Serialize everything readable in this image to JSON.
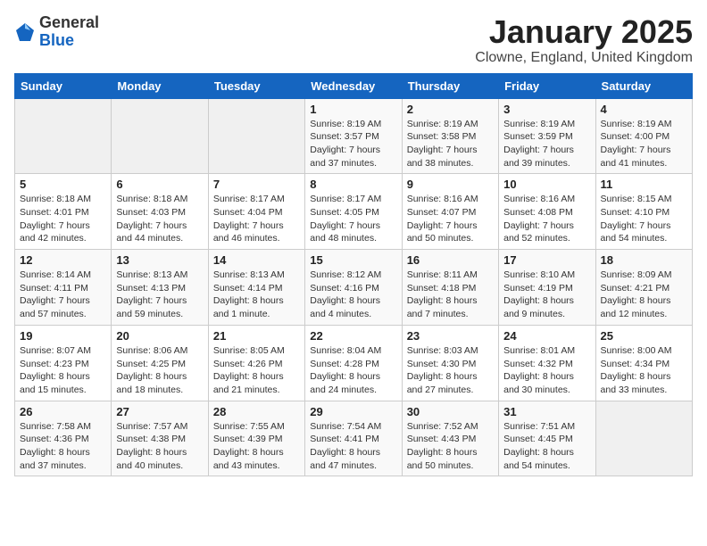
{
  "header": {
    "logo_general": "General",
    "logo_blue": "Blue",
    "title": "January 2025",
    "subtitle": "Clowne, England, United Kingdom"
  },
  "weekdays": [
    "Sunday",
    "Monday",
    "Tuesday",
    "Wednesday",
    "Thursday",
    "Friday",
    "Saturday"
  ],
  "weeks": [
    [
      {
        "day": "",
        "empty": true
      },
      {
        "day": "",
        "empty": true
      },
      {
        "day": "",
        "empty": true
      },
      {
        "day": "1",
        "info": "Sunrise: 8:19 AM\nSunset: 3:57 PM\nDaylight: 7 hours\nand 37 minutes."
      },
      {
        "day": "2",
        "info": "Sunrise: 8:19 AM\nSunset: 3:58 PM\nDaylight: 7 hours\nand 38 minutes."
      },
      {
        "day": "3",
        "info": "Sunrise: 8:19 AM\nSunset: 3:59 PM\nDaylight: 7 hours\nand 39 minutes."
      },
      {
        "day": "4",
        "info": "Sunrise: 8:19 AM\nSunset: 4:00 PM\nDaylight: 7 hours\nand 41 minutes."
      }
    ],
    [
      {
        "day": "5",
        "info": "Sunrise: 8:18 AM\nSunset: 4:01 PM\nDaylight: 7 hours\nand 42 minutes."
      },
      {
        "day": "6",
        "info": "Sunrise: 8:18 AM\nSunset: 4:03 PM\nDaylight: 7 hours\nand 44 minutes."
      },
      {
        "day": "7",
        "info": "Sunrise: 8:17 AM\nSunset: 4:04 PM\nDaylight: 7 hours\nand 46 minutes."
      },
      {
        "day": "8",
        "info": "Sunrise: 8:17 AM\nSunset: 4:05 PM\nDaylight: 7 hours\nand 48 minutes."
      },
      {
        "day": "9",
        "info": "Sunrise: 8:16 AM\nSunset: 4:07 PM\nDaylight: 7 hours\nand 50 minutes."
      },
      {
        "day": "10",
        "info": "Sunrise: 8:16 AM\nSunset: 4:08 PM\nDaylight: 7 hours\nand 52 minutes."
      },
      {
        "day": "11",
        "info": "Sunrise: 8:15 AM\nSunset: 4:10 PM\nDaylight: 7 hours\nand 54 minutes."
      }
    ],
    [
      {
        "day": "12",
        "info": "Sunrise: 8:14 AM\nSunset: 4:11 PM\nDaylight: 7 hours\nand 57 minutes."
      },
      {
        "day": "13",
        "info": "Sunrise: 8:13 AM\nSunset: 4:13 PM\nDaylight: 7 hours\nand 59 minutes."
      },
      {
        "day": "14",
        "info": "Sunrise: 8:13 AM\nSunset: 4:14 PM\nDaylight: 8 hours\nand 1 minute."
      },
      {
        "day": "15",
        "info": "Sunrise: 8:12 AM\nSunset: 4:16 PM\nDaylight: 8 hours\nand 4 minutes."
      },
      {
        "day": "16",
        "info": "Sunrise: 8:11 AM\nSunset: 4:18 PM\nDaylight: 8 hours\nand 7 minutes."
      },
      {
        "day": "17",
        "info": "Sunrise: 8:10 AM\nSunset: 4:19 PM\nDaylight: 8 hours\nand 9 minutes."
      },
      {
        "day": "18",
        "info": "Sunrise: 8:09 AM\nSunset: 4:21 PM\nDaylight: 8 hours\nand 12 minutes."
      }
    ],
    [
      {
        "day": "19",
        "info": "Sunrise: 8:07 AM\nSunset: 4:23 PM\nDaylight: 8 hours\nand 15 minutes."
      },
      {
        "day": "20",
        "info": "Sunrise: 8:06 AM\nSunset: 4:25 PM\nDaylight: 8 hours\nand 18 minutes."
      },
      {
        "day": "21",
        "info": "Sunrise: 8:05 AM\nSunset: 4:26 PM\nDaylight: 8 hours\nand 21 minutes."
      },
      {
        "day": "22",
        "info": "Sunrise: 8:04 AM\nSunset: 4:28 PM\nDaylight: 8 hours\nand 24 minutes."
      },
      {
        "day": "23",
        "info": "Sunrise: 8:03 AM\nSunset: 4:30 PM\nDaylight: 8 hours\nand 27 minutes."
      },
      {
        "day": "24",
        "info": "Sunrise: 8:01 AM\nSunset: 4:32 PM\nDaylight: 8 hours\nand 30 minutes."
      },
      {
        "day": "25",
        "info": "Sunrise: 8:00 AM\nSunset: 4:34 PM\nDaylight: 8 hours\nand 33 minutes."
      }
    ],
    [
      {
        "day": "26",
        "info": "Sunrise: 7:58 AM\nSunset: 4:36 PM\nDaylight: 8 hours\nand 37 minutes."
      },
      {
        "day": "27",
        "info": "Sunrise: 7:57 AM\nSunset: 4:38 PM\nDaylight: 8 hours\nand 40 minutes."
      },
      {
        "day": "28",
        "info": "Sunrise: 7:55 AM\nSunset: 4:39 PM\nDaylight: 8 hours\nand 43 minutes."
      },
      {
        "day": "29",
        "info": "Sunrise: 7:54 AM\nSunset: 4:41 PM\nDaylight: 8 hours\nand 47 minutes."
      },
      {
        "day": "30",
        "info": "Sunrise: 7:52 AM\nSunset: 4:43 PM\nDaylight: 8 hours\nand 50 minutes."
      },
      {
        "day": "31",
        "info": "Sunrise: 7:51 AM\nSunset: 4:45 PM\nDaylight: 8 hours\nand 54 minutes."
      },
      {
        "day": "",
        "empty": true
      }
    ]
  ]
}
